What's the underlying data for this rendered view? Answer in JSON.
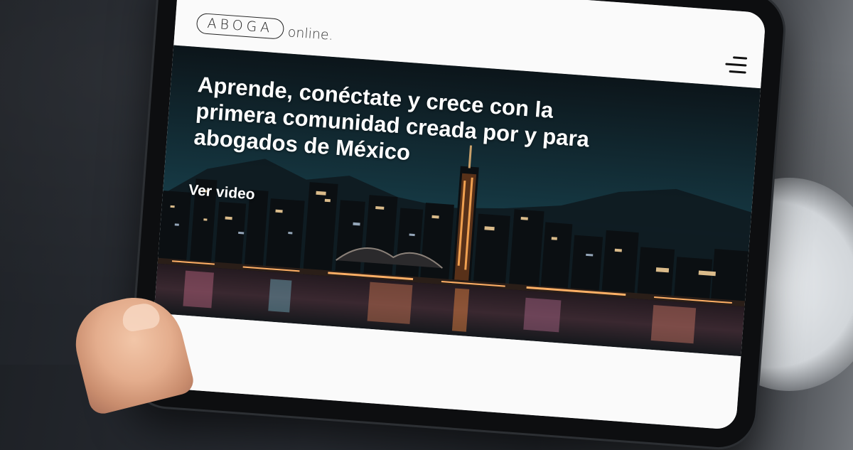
{
  "site": {
    "logo_text": "ABOGA",
    "logo_suffix": "online."
  },
  "header": {
    "menu_icon": "hamburger-menu-icon"
  },
  "hero": {
    "title": "Aprende, conéctate y crece con la primera comunidad creada por y para abogados de México",
    "cta_label": "Ver video",
    "background": "city-skyline-night-image"
  },
  "colors": {
    "header_bg": "#fafafa",
    "text_dark": "#1c1c1c",
    "hero_text": "#ffffff",
    "device_frame": "#0d0e10"
  }
}
